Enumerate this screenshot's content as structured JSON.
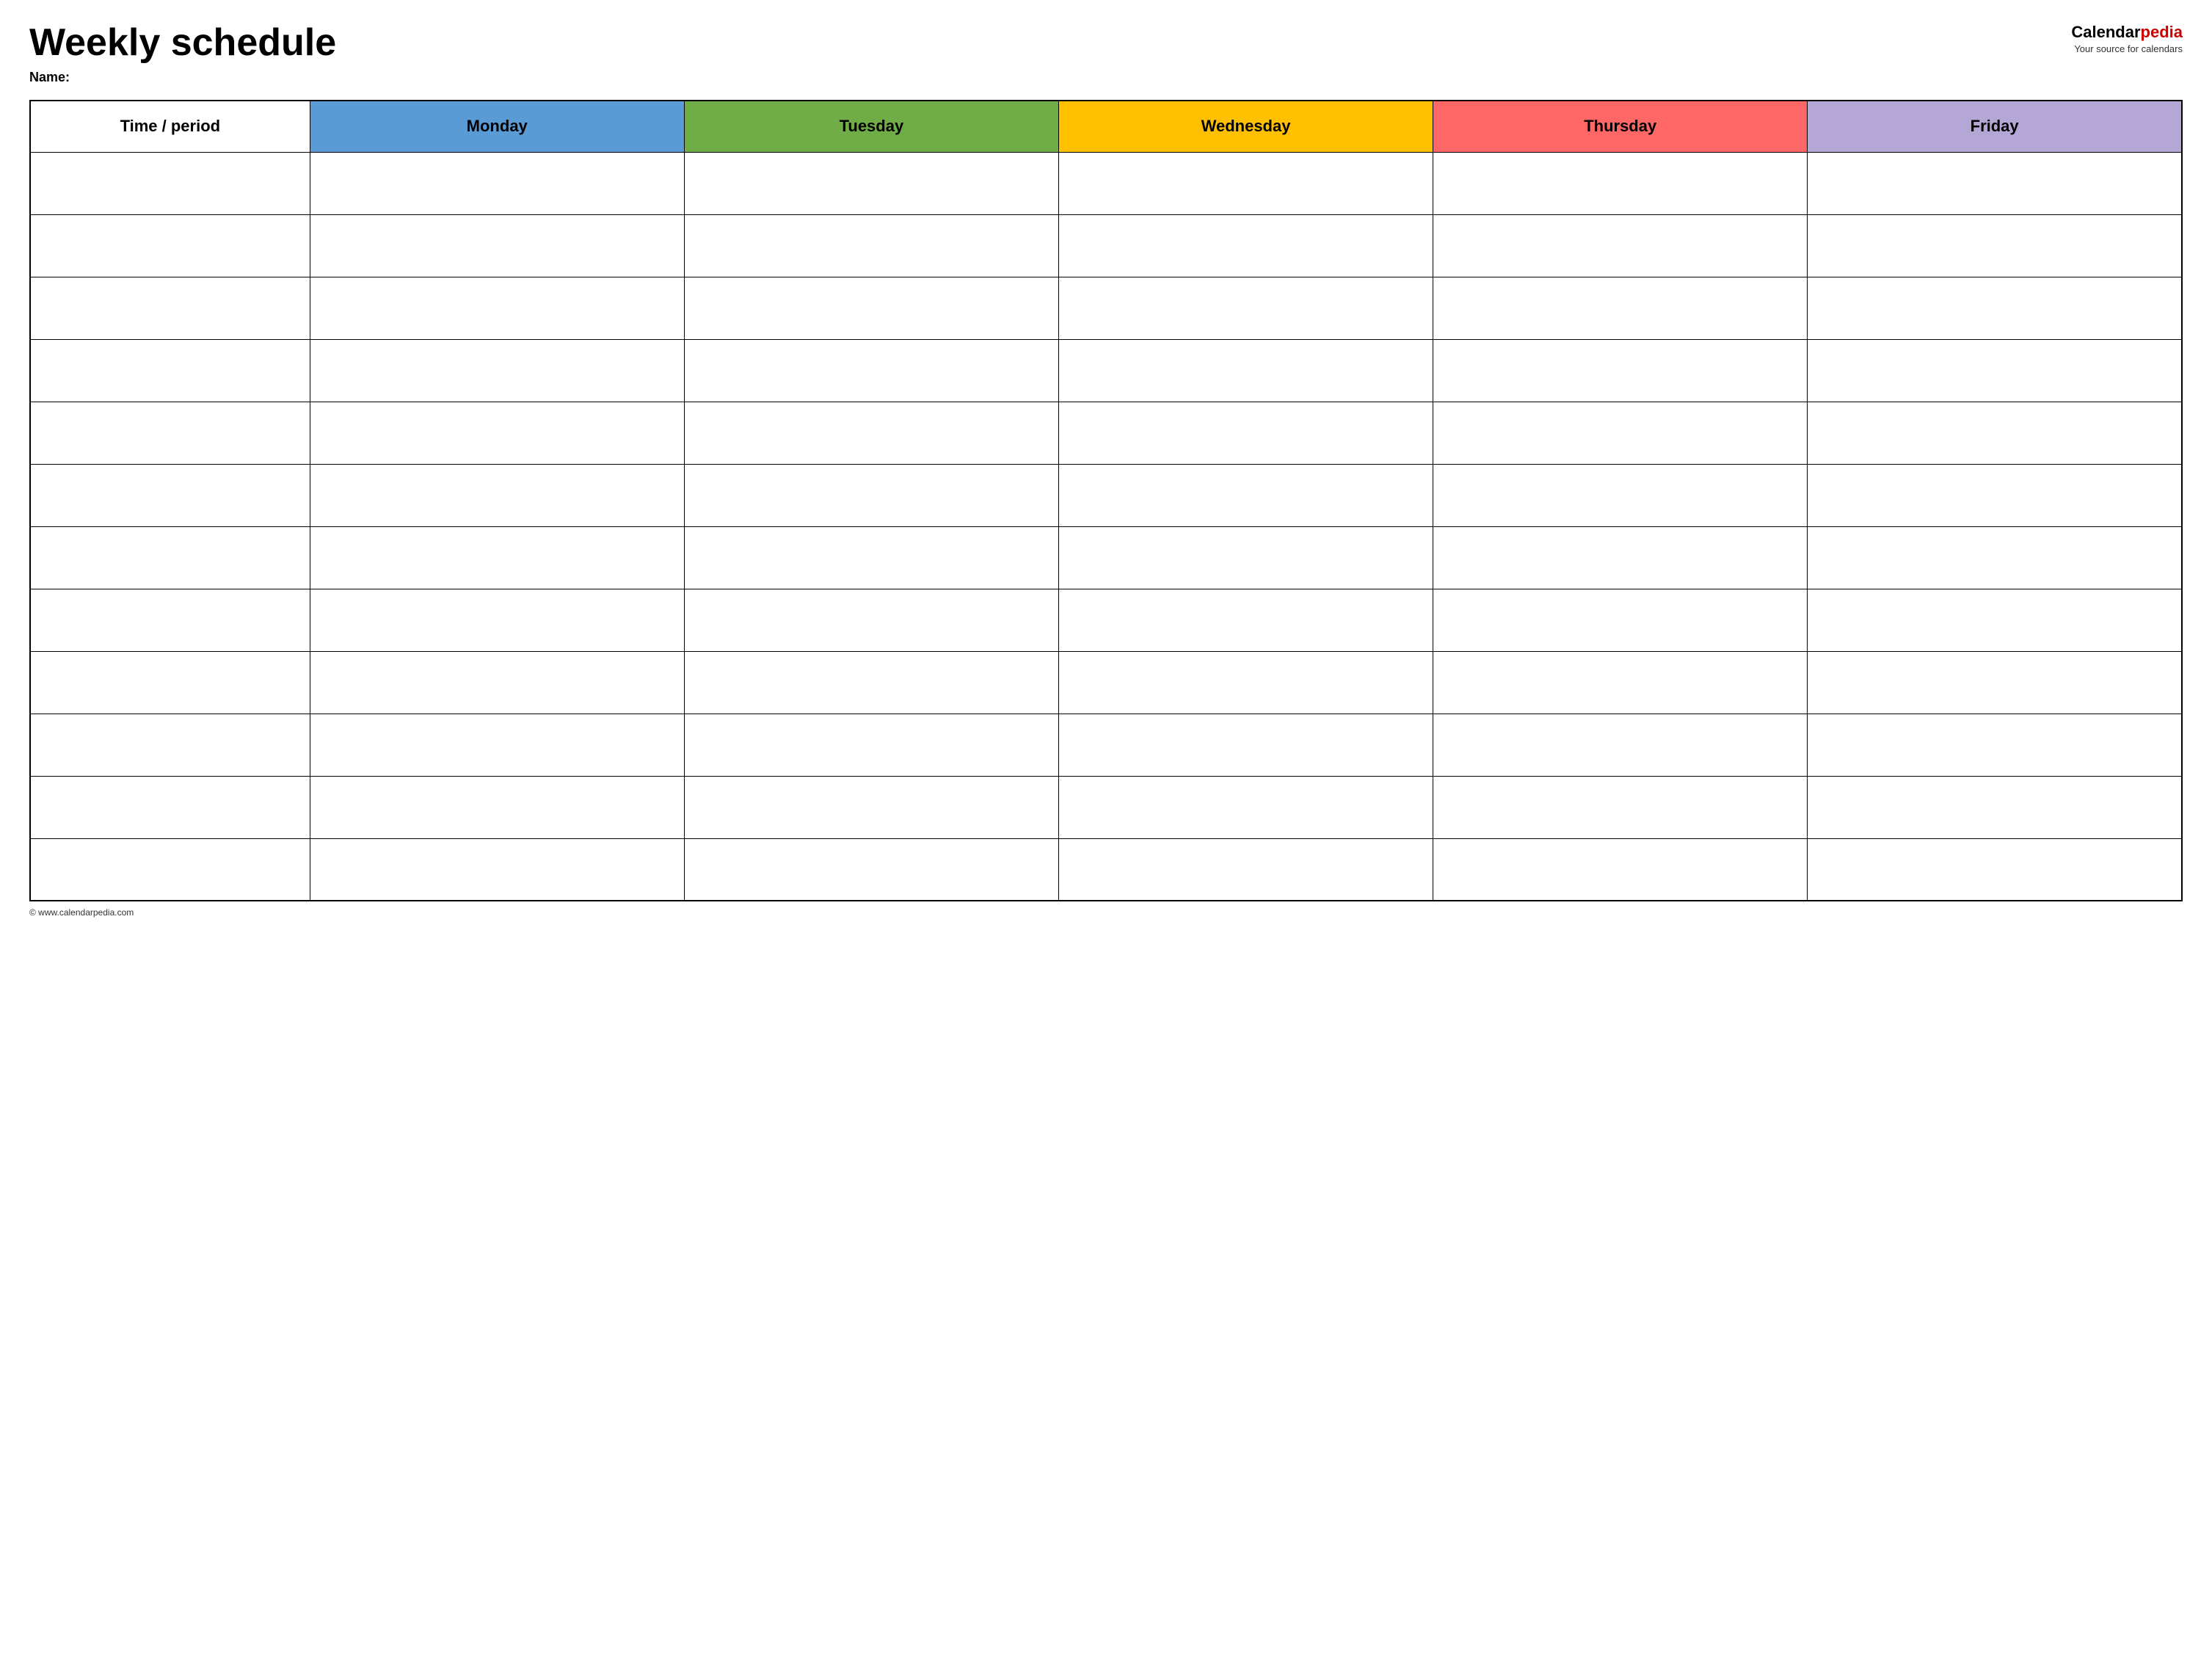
{
  "header": {
    "title": "Weekly schedule",
    "name_label": "Name:",
    "logo_part1": "Calendar",
    "logo_part2": "pedia",
    "logo_tagline": "Your source for calendars"
  },
  "table": {
    "columns": [
      {
        "key": "time",
        "label": "Time / period",
        "color": "#ffffff"
      },
      {
        "key": "monday",
        "label": "Monday",
        "color": "#5b9bd5"
      },
      {
        "key": "tuesday",
        "label": "Tuesday",
        "color": "#70ad47"
      },
      {
        "key": "wednesday",
        "label": "Wednesday",
        "color": "#ffc000"
      },
      {
        "key": "thursday",
        "label": "Thursday",
        "color": "#ff6666"
      },
      {
        "key": "friday",
        "label": "Friday",
        "color": "#b4a7d6"
      }
    ],
    "row_count": 12
  },
  "footer": {
    "url": "© www.calendarpedia.com"
  }
}
